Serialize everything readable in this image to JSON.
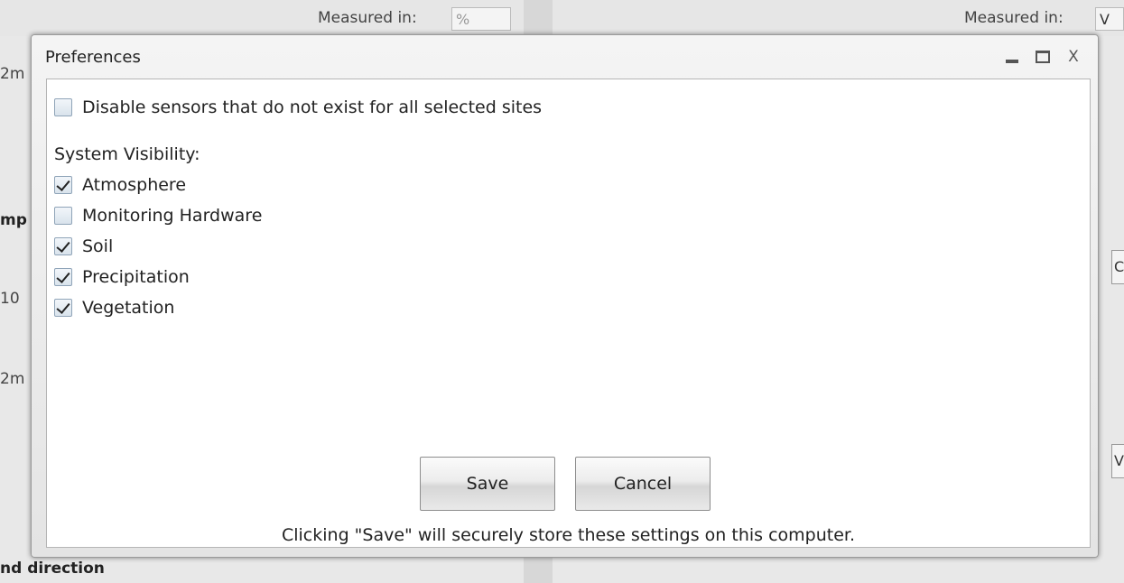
{
  "background": {
    "measured_left_label": "Measured in:",
    "measured_left_value": "%",
    "measured_right_label": "Measured in:",
    "measured_right_value": "V",
    "left_fragments": [
      "2m",
      "mp",
      "10",
      "2m"
    ],
    "bottom_left_label": "nd direction",
    "right_fragments": [
      "C",
      "V"
    ]
  },
  "dialog": {
    "title": "Preferences",
    "window_controls": {
      "minimize": "minimize-icon",
      "maximize": "maximize-icon",
      "close": "X"
    },
    "disable_sensors": {
      "label": "Disable sensors that do not exist for all selected sites",
      "checked": false
    },
    "system_visibility": {
      "label": "System Visibility:",
      "items": [
        {
          "label": "Atmosphere",
          "checked": true
        },
        {
          "label": "Monitoring Hardware",
          "checked": false
        },
        {
          "label": "Soil",
          "checked": true
        },
        {
          "label": "Precipitation",
          "checked": true
        },
        {
          "label": "Vegetation",
          "checked": true
        }
      ]
    },
    "save_label": "Save",
    "cancel_label": "Cancel",
    "note": "Clicking \"Save\" will securely store these settings on this computer."
  }
}
